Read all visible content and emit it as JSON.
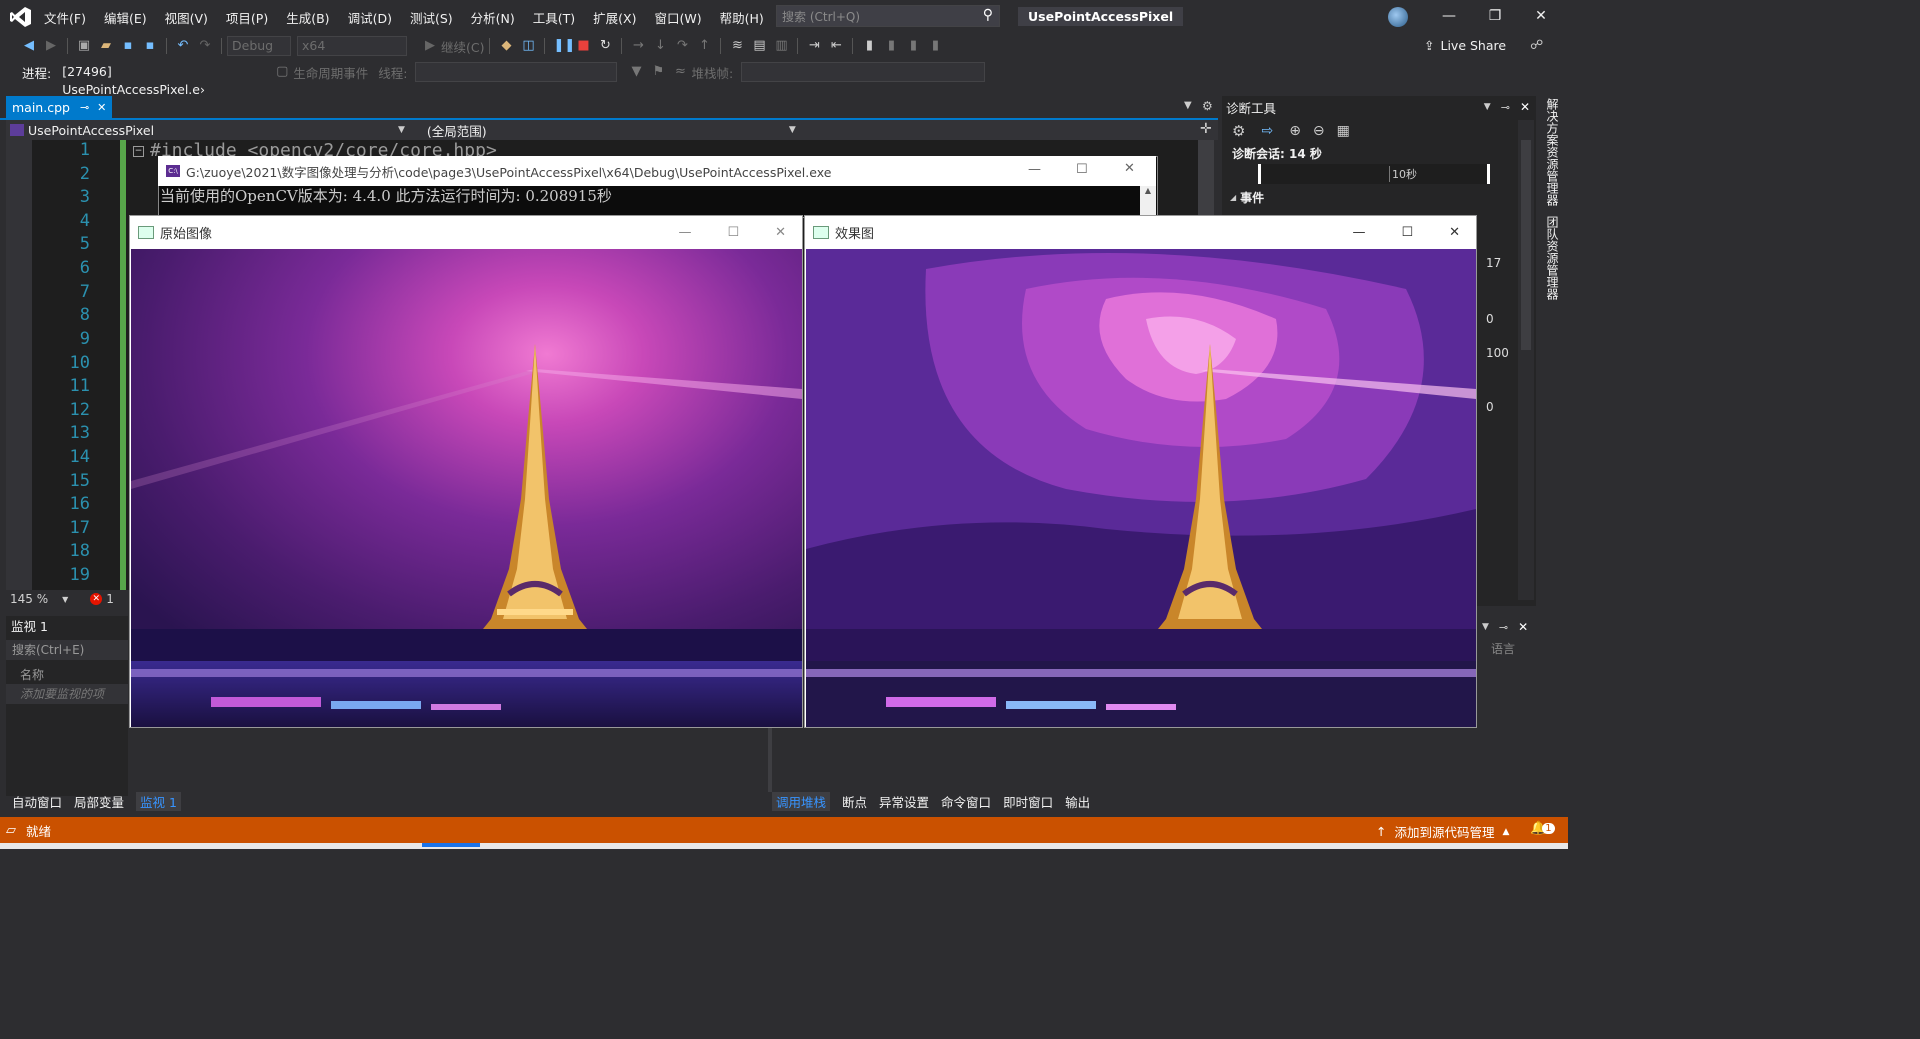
{
  "menu": [
    "文件(F)",
    "编辑(E)",
    "视图(V)",
    "项目(P)",
    "生成(B)",
    "调试(D)",
    "测试(S)",
    "分析(N)",
    "工具(T)",
    "扩展(X)",
    "窗口(W)",
    "帮助(H)"
  ],
  "search_placeholder": "搜索 (Ctrl+Q)",
  "project_title": "UsePointAccessPixel",
  "toolbar": {
    "config": "Debug",
    "platform": "x64",
    "continue_label": "继续(C)",
    "live_share": "Live Share"
  },
  "debug_bar": {
    "process_label": "进程:",
    "process_value": "[27496] UsePointAccessPixel.e›",
    "lifecycle_label": "生命周期事件",
    "thread_label": "线程:",
    "stack_label": "堆栈帧:"
  },
  "editor": {
    "tab_name": "main.cpp",
    "nav_left": "UsePointAccessPixel",
    "nav_scope": "(全局范围)",
    "first_code_line": "#include <opencv2/core/core.hpp>",
    "line_numbers": [
      "1",
      "2",
      "3",
      "4",
      "5",
      "6",
      "7",
      "8",
      "9",
      "10",
      "11",
      "12",
      "13",
      "14",
      "15",
      "16",
      "17",
      "18",
      "19"
    ],
    "zoom": "145 %",
    "error_count": "1"
  },
  "console": {
    "title": "G:\\zuoye\\2021\\数字图像处理与分析\\code\\page3\\UsePointAccessPixel\\x64\\Debug\\UsePointAccessPixel.exe",
    "output": "当前使用的OpenCV版本为: 4.4.0    此方法运行时间为:   0.208915秒"
  },
  "windows": {
    "original_title": "原始图像",
    "effect_title": "效果图"
  },
  "watch": {
    "title": "监视 1",
    "search": "搜索(Ctrl+E)",
    "col_name": "名称",
    "add_placeholder": "添加要监视的项"
  },
  "bottom_left_tabs": [
    "自动窗口",
    "局部变量",
    "监视 1"
  ],
  "bottom_mid_tabs": [
    "调用堆栈",
    "断点",
    "异常设置",
    "命令窗口",
    "即时窗口",
    "输出"
  ],
  "diag": {
    "title": "诊断工具",
    "session": "诊断会话: 14 秒",
    "timeline_label": "10秒",
    "events": "事件",
    "values": [
      "17",
      "0",
      "100",
      "0"
    ],
    "lang_label": "语言"
  },
  "vertical_tabs": [
    "解决方案资源管理器",
    "团队资源管理器"
  ],
  "status": {
    "ready": "就绪",
    "source_control": "添加到源代码管理",
    "notifications": "1"
  },
  "colors": {
    "accent": "#007acc",
    "status_bar": "#ca5100",
    "bg": "#2d2d30",
    "editor_bg": "#1e1e1e"
  }
}
